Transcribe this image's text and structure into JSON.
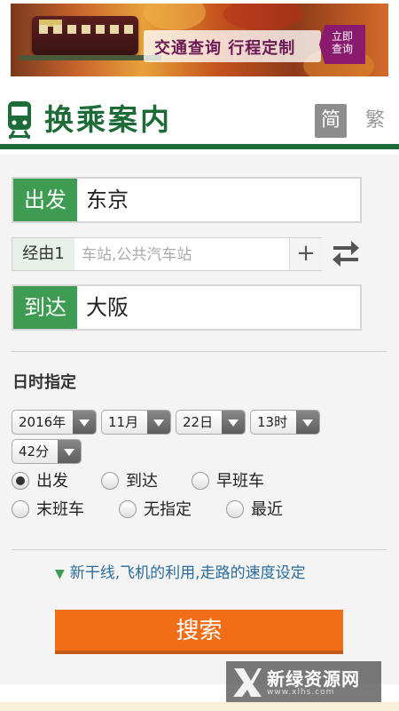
{
  "banner": {
    "slogan": "交通查询 行程定制",
    "cta_line1": "立即",
    "cta_line2": "查询"
  },
  "header": {
    "title": "换乘案内",
    "lang_simplified": "简",
    "lang_traditional": "繁"
  },
  "form": {
    "departure_label": "出发",
    "departure_value": "东京",
    "via_label": "经由1",
    "via_placeholder": "车站,公共汽车站",
    "via_add": "+",
    "arrival_label": "到达",
    "arrival_value": "大阪"
  },
  "datetime": {
    "section_title": "日时指定",
    "year": "2016年",
    "month": "11月",
    "day": "22日",
    "hour": "13时",
    "minute": "42分",
    "options": [
      {
        "label": "出发",
        "checked": true
      },
      {
        "label": "到达",
        "checked": false
      },
      {
        "label": "早班车",
        "checked": false
      },
      {
        "label": "末班车",
        "checked": false
      },
      {
        "label": "无指定",
        "checked": false
      },
      {
        "label": "最近",
        "checked": false
      }
    ]
  },
  "advanced_link": "新干线,飞机的利用,走路的速度设定",
  "search_button": "搜索",
  "watermark": {
    "text": "新绿资源网",
    "sub": "www.xlhs.com"
  },
  "colors": {
    "brand_green": "#1d6b37",
    "label_green": "#3e9b52",
    "search_orange": "#f26d17",
    "link_blue": "#2a6d9c"
  }
}
